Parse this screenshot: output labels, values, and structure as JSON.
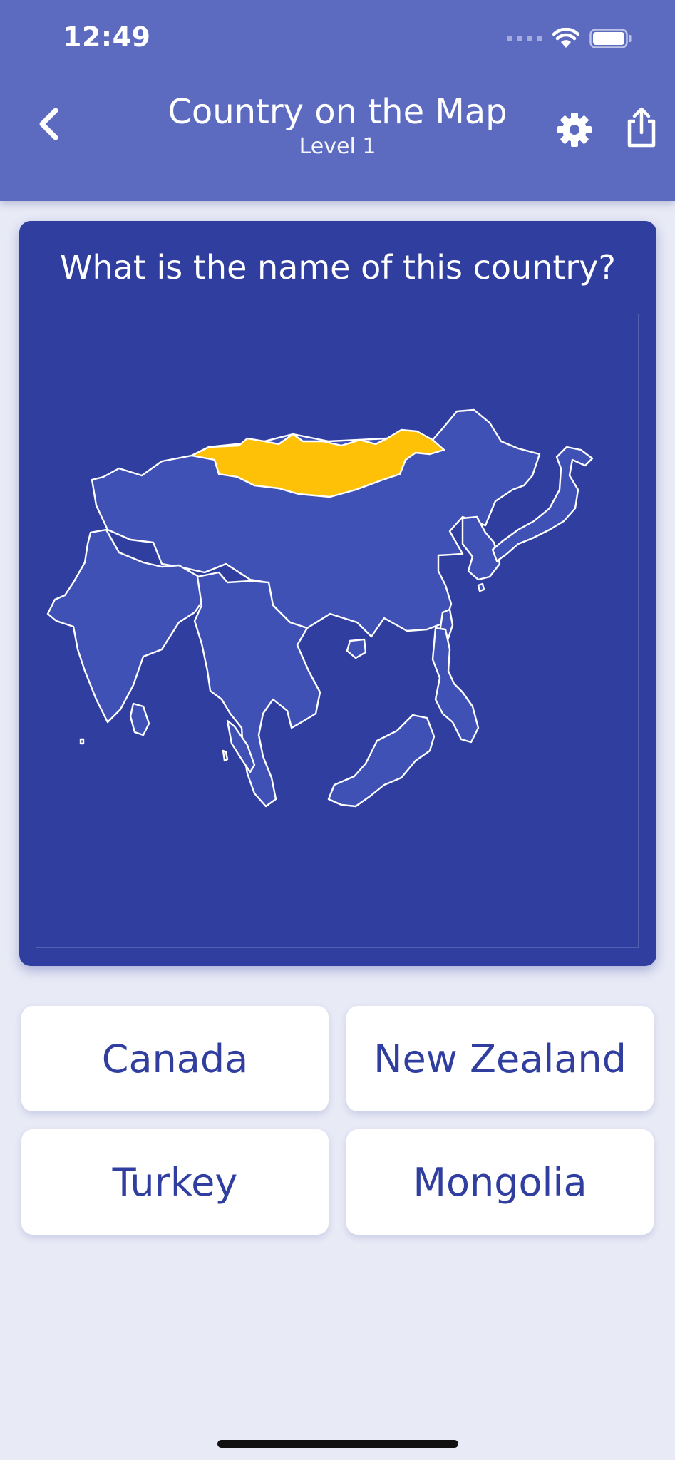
{
  "status_bar": {
    "time": "12:49"
  },
  "header": {
    "title": "Country on the Map",
    "subtitle": "Level 1",
    "back_icon": "chevron-left-icon",
    "settings_icon": "gear-icon",
    "share_icon": "share-icon"
  },
  "quiz": {
    "question": "What is the name of this country?",
    "answers": [
      "Canada",
      "New Zealand",
      "Turkey",
      "Mongolia"
    ]
  },
  "colors": {
    "header_bg": "#5c6bc0",
    "card_bg": "#303f9f",
    "land_fill": "#3f51b5",
    "highlight_fill": "#ffc107",
    "answer_text": "#303f9f",
    "page_bg": "#e8eaf6"
  }
}
